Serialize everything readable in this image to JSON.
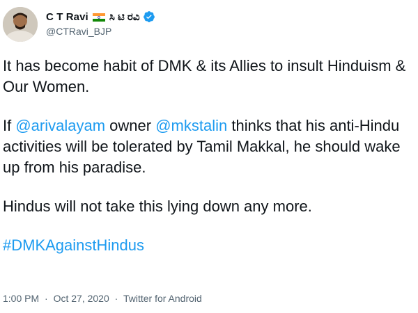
{
  "author": {
    "display_name": "C T Ravi",
    "native_name": "ಸಿ ಟಿ ರವಿ",
    "handle": "@CTRavi_BJP",
    "flag_icon": "india-flag-icon",
    "verified_icon": "verified-badge-icon"
  },
  "tweet": {
    "para1": "It has become habit of DMK & its Allies to insult Hinduism & Our Women.",
    "para2_prefix": "If ",
    "mention1": "@arivalayam",
    "para2_mid": " owner ",
    "mention2": "@mkstalin",
    "para2_suffix": " thinks that his anti-Hindu activities will be tolerated by Tamil Makkal, he should wake up from his paradise.",
    "para3": "Hindus will not take this lying down any more.",
    "hashtag": "#DMKAgainstHindus"
  },
  "meta": {
    "time": "1:00 PM",
    "separator": "·",
    "date": "Oct 27, 2020",
    "source": "Twitter for Android"
  },
  "colors": {
    "link": "#1d9bf0",
    "text": "#0f1419",
    "muted": "#536471"
  }
}
